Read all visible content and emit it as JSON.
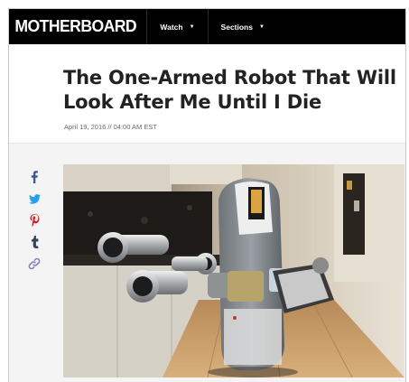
{
  "site": {
    "logo": "MOTHERBOARD"
  },
  "nav": {
    "items": [
      {
        "label": "Watch"
      },
      {
        "label": "Sections"
      }
    ]
  },
  "article": {
    "title": "The One-Armed Robot That Will Look After Me Until I Die",
    "dateline": "April 19, 2016 // 04:00 AM EST"
  },
  "share": {
    "icons": [
      "facebook-icon",
      "twitter-icon",
      "pinterest-icon",
      "tumblr-icon",
      "link-icon"
    ],
    "colors": {
      "facebook": "#3b5998",
      "twitter": "#1da1f2",
      "pinterest": "#cb2027",
      "tumblr": "#35465c",
      "link": "#8a7fb8"
    }
  },
  "theme": {
    "navbar_bg": "#000000",
    "title_color": "#222222"
  },
  "hero_image": {
    "subject": "robot-in-kitchen"
  }
}
